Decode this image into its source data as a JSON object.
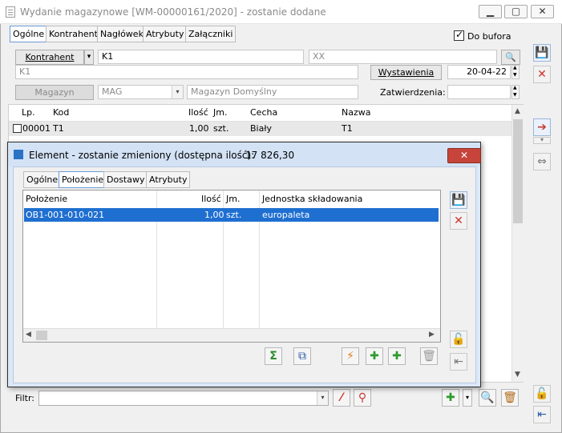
{
  "window": {
    "title": "Wydanie magazynowe [WM-00000161/2020]  - zostanie dodane",
    "min_icon": "minimize-icon",
    "max_icon": "maximize-icon",
    "close_icon": "close-icon"
  },
  "tabs": [
    "Ogólne",
    "Kontrahent",
    "Nagłówek",
    "Atrybuty",
    "Załączniki"
  ],
  "do_bufora": {
    "label": "Do bufora",
    "checked": true
  },
  "header": {
    "kontrahent_button": "Kontrahent",
    "kontrahent_code": "K1",
    "kontrahent_ext": "XX",
    "kontrahent_name": "K1",
    "wystawienia_button": "Wystawienia",
    "wystawienia_date": "20-04-22",
    "magazyn_button": "Magazyn",
    "magazyn_code": "MAG",
    "magazyn_name": "Magazyn Domyślny",
    "zatwierdzenia_label": "Zatwierdzenia:",
    "zatwierdzenia_value": ""
  },
  "grid": {
    "columns": [
      "Lp.",
      "Kod",
      "Ilość",
      "Jm.",
      "Cecha",
      "Nazwa"
    ],
    "rows": [
      {
        "lp": "00001",
        "kod": "T1",
        "ilosc": "1,00",
        "jm": "szt.",
        "cecha": "Biały",
        "nazwa": "T1"
      }
    ]
  },
  "filter": {
    "label": "Filtr:",
    "value": ""
  },
  "dialog": {
    "title": "Element - zostanie zmieniony (dostępna ilość):",
    "available": "17 826,30",
    "close_label": "✕",
    "tabs": [
      "Ogólne",
      "Położenie",
      "Dostawy",
      "Atrybuty"
    ],
    "columns": [
      "Położenie",
      "Ilość",
      "Jm.",
      "Jednostka składowania"
    ],
    "rows": [
      {
        "polozenie": "OB1-001-010-021",
        "ilosc": "1,00",
        "jm": "szt.",
        "jednostka": "europaleta"
      }
    ]
  },
  "colors": {
    "selection": "#1f6fd1",
    "dialog_bg": "#dbe8f7",
    "close_red": "#c7443a"
  }
}
